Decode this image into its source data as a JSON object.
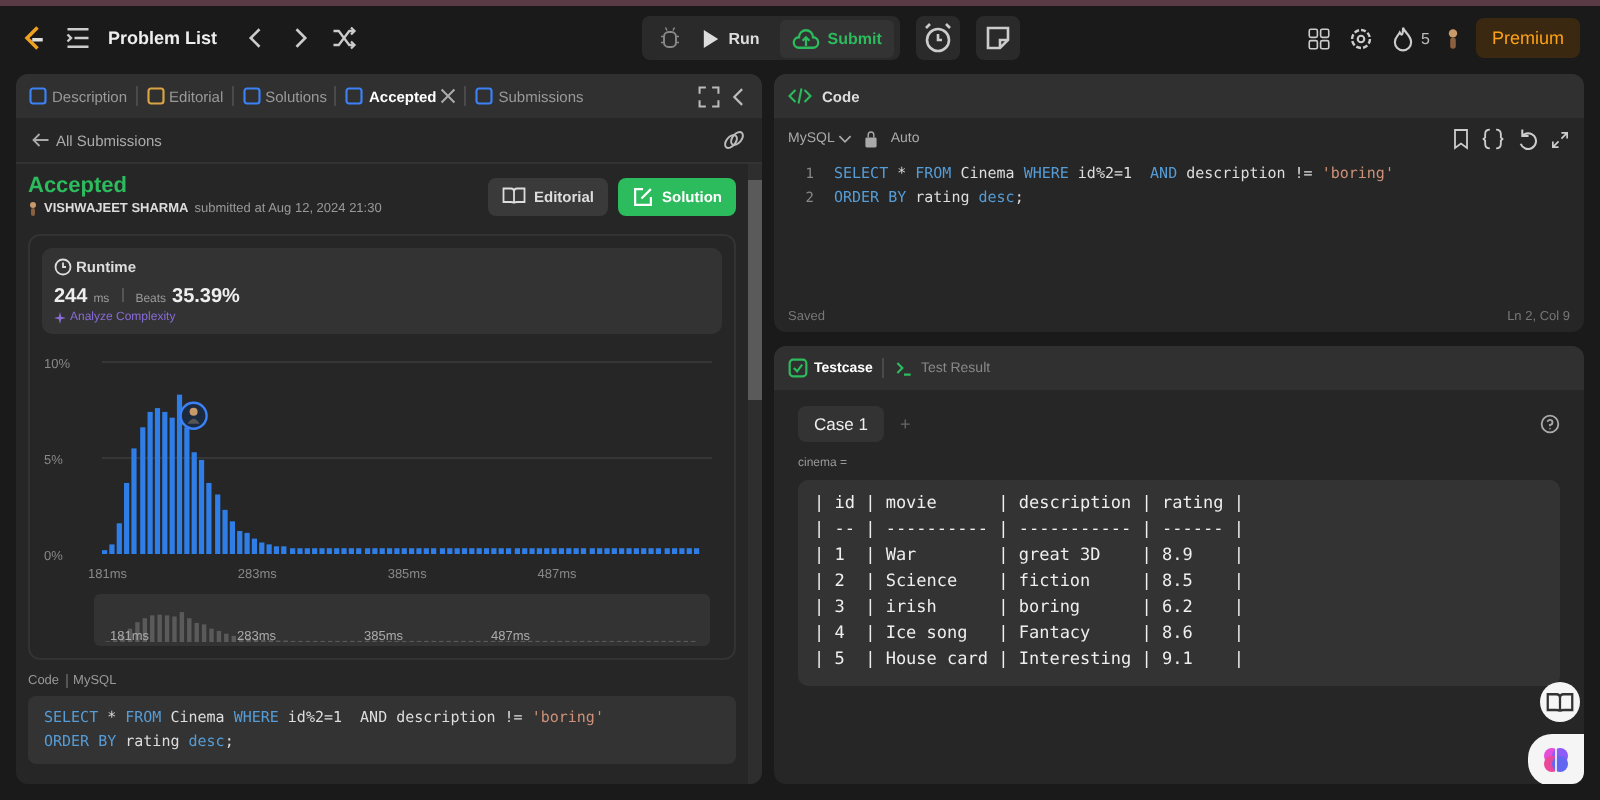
{
  "topbar": {
    "title": "Problem List",
    "run": "Run",
    "submit": "Submit",
    "streak": "5",
    "premium": "Premium"
  },
  "tabs": [
    {
      "label": "Description",
      "selected": false,
      "closable": false
    },
    {
      "label": "Editorial",
      "selected": false,
      "closable": false
    },
    {
      "label": "Solutions",
      "selected": false,
      "closable": false
    },
    {
      "label": "Accepted",
      "selected": true,
      "closable": true
    },
    {
      "label": "Submissions",
      "selected": false,
      "closable": false
    }
  ],
  "submission": {
    "back": "All Submissions",
    "status": "Accepted",
    "user": "VISHWAJEET SHARMA",
    "submitted": "submitted at Aug 12, 2024 21:30",
    "buttons": [
      {
        "label": "Editorial",
        "kind": "secondary"
      },
      {
        "label": "Solution",
        "kind": "primary"
      }
    ],
    "runtime": {
      "title": "Runtime",
      "value": "244",
      "unit": "ms",
      "beats_label": "Beats",
      "beats": "35.39%",
      "analyze": "Analyze Complexity"
    },
    "chart_data": {
      "type": "bar",
      "ylim": [
        0,
        10
      ],
      "yticks": [
        {
          "value": 0,
          "label": "0%"
        },
        {
          "value": 5,
          "label": "5%"
        },
        {
          "value": 10,
          "label": "10%"
        }
      ],
      "x": [
        181,
        186,
        191,
        196,
        201,
        207,
        212,
        217,
        222,
        227,
        232,
        237,
        242,
        247,
        252,
        258,
        263,
        268,
        273,
        278,
        283,
        288,
        293,
        298,
        303,
        309,
        314,
        319,
        324,
        329,
        334,
        339,
        344,
        349,
        354,
        360,
        365,
        370,
        375,
        380,
        385,
        390,
        395,
        400,
        405,
        411,
        416,
        421,
        426,
        431,
        436,
        441,
        446,
        451,
        456,
        462,
        467,
        472,
        477,
        482,
        487,
        492,
        497,
        502,
        507,
        513,
        518,
        523,
        528,
        533,
        538,
        543,
        548,
        553,
        558,
        564,
        569,
        574,
        579,
        584
      ],
      "xlim": [
        181,
        584
      ],
      "xticks": [
        {
          "value": 181,
          "label": "181ms"
        },
        {
          "value": 283,
          "label": "283ms"
        },
        {
          "value": 385,
          "label": "385ms"
        },
        {
          "value": 487,
          "label": "487ms"
        }
      ],
      "values": [
        0.2,
        0.5,
        1.6,
        3.7,
        5.5,
        6.6,
        7.4,
        7.6,
        7.4,
        7.1,
        8.3,
        6.6,
        5.3,
        4.9,
        3.7,
        3.1,
        2.3,
        1.7,
        1.2,
        1.1,
        0.8,
        0.6,
        0.5,
        0.4,
        0.4,
        0.3,
        0.3,
        0.3,
        0.3,
        0.3,
        0.3,
        0.3,
        0.3,
        0.3,
        0.3,
        0.3,
        0.3,
        0.3,
        0.3,
        0.3,
        0.3,
        0.3,
        0.3,
        0.3,
        0.3,
        0.3,
        0.3,
        0.3,
        0.3,
        0.3,
        0.3,
        0.3,
        0.3,
        0.3,
        0.3,
        0.3,
        0.3,
        0.3,
        0.3,
        0.3,
        0.3,
        0.3,
        0.3,
        0.3,
        0.3,
        0.3,
        0.3,
        0.3,
        0.3,
        0.3,
        0.3,
        0.3,
        0.3,
        0.3,
        0.3,
        0.3,
        0.3,
        0.3,
        0.3,
        0.3
      ]
    },
    "overview_labels": [
      "181ms",
      "283ms",
      "385ms",
      "487ms"
    ],
    "code_label": "Code",
    "language": "MySQL",
    "code": [
      [
        {
          "text": "SELECT",
          "kind": "keyword"
        },
        {
          "text": " * ",
          "kind": "plain"
        },
        {
          "text": "FROM",
          "kind": "keyword"
        },
        {
          "text": " Cinema ",
          "kind": "plain"
        },
        {
          "text": "WHERE",
          "kind": "keyword"
        },
        {
          "text": " id%2=1  AND description != ",
          "kind": "plain"
        },
        {
          "text": "'boring'",
          "kind": "string"
        }
      ],
      [
        {
          "text": "ORDER BY",
          "kind": "keyword"
        },
        {
          "text": " rating ",
          "kind": "plain"
        },
        {
          "text": "desc",
          "kind": "keyword"
        },
        {
          "text": ";",
          "kind": "plain"
        }
      ]
    ]
  },
  "editor": {
    "title": "Code",
    "language": "MySQL",
    "mode": "Auto",
    "lines": [
      {
        "number": "1",
        "tokens": [
          {
            "text": "SELECT",
            "kind": "keyword"
          },
          {
            "text": " * ",
            "kind": "plain"
          },
          {
            "text": "FROM",
            "kind": "keyword"
          },
          {
            "text": " Cinema ",
            "kind": "plain"
          },
          {
            "text": "WHERE",
            "kind": "keyword"
          },
          {
            "text": " id%2=1  ",
            "kind": "plain"
          },
          {
            "text": "AND",
            "kind": "keyword"
          },
          {
            "text": " description != ",
            "kind": "plain"
          },
          {
            "text": "'boring'",
            "kind": "string"
          }
        ]
      },
      {
        "number": "2",
        "tokens": [
          {
            "text": "ORDER BY",
            "kind": "keyword"
          },
          {
            "text": " rating ",
            "kind": "plain"
          },
          {
            "text": "desc",
            "kind": "keyword"
          },
          {
            "text": ";",
            "kind": "plain"
          }
        ]
      }
    ],
    "status": "Saved",
    "cursor": "Ln 2, Col 9"
  },
  "testcase": {
    "tabs": [
      {
        "label": "Testcase",
        "selected": true
      },
      {
        "label": "Test Result",
        "selected": false
      }
    ],
    "case": "Case 1",
    "add": "+",
    "param": "cinema =",
    "table": [
      "| id | movie      | description | rating |",
      "| -- | ---------- | ----------- | ------ |",
      "| 1  | War        | great 3D    | 8.9    |",
      "| 2  | Science    | fiction     | 8.5    |",
      "| 3  | irish      | boring      | 6.2    |",
      "| 4  | Ice song   | Fantacy     | 8.6    |",
      "| 5  | House card | Interesting | 9.1    |"
    ]
  }
}
